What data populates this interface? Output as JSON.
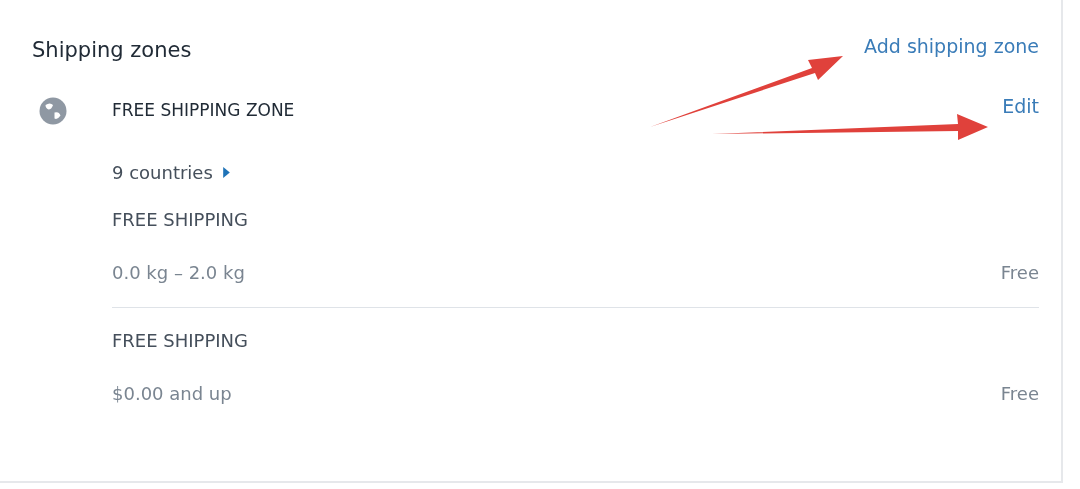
{
  "card": {
    "title": "Shipping zones",
    "action": "Add shipping zone"
  },
  "zone": {
    "name": "FREE SHIPPING ZONE",
    "action": "Edit",
    "countries": "9 countries",
    "rates": [
      {
        "name": "FREE SHIPPING",
        "condition": "0.0 kg – 2.0 kg",
        "price": "Free"
      },
      {
        "name": "FREE SHIPPING",
        "condition": "$0.00 and up",
        "price": "Free"
      }
    ]
  }
}
